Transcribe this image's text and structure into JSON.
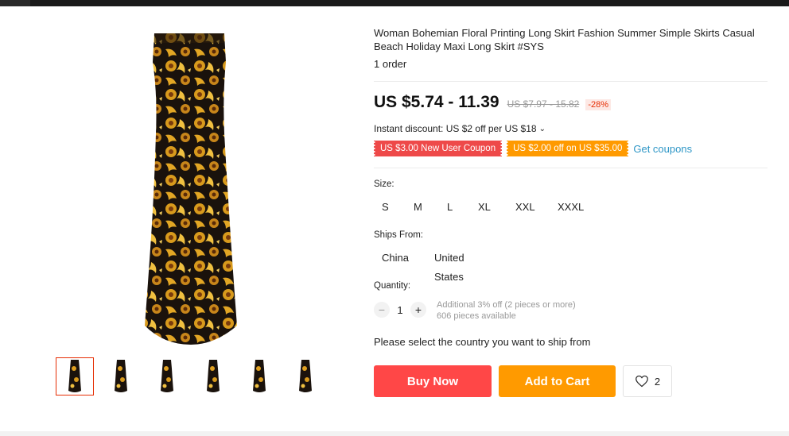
{
  "product": {
    "title": "Woman Bohemian Floral Printing Long Skirt Fashion Summer Simple Skirts Casual Beach Holiday Maxi Long Skirt #SYS",
    "orders": "1 order",
    "price": "US $5.74 - 11.39",
    "old_price": "US $7.97 - 15.82",
    "discount": "-28%",
    "instant_discount": "Instant discount: US $2 off per US $18",
    "coupons": [
      "US $3.00 New User Coupon",
      "US $2.00 off on US $35.00"
    ],
    "get_coupons": "Get coupons"
  },
  "size": {
    "label": "Size:",
    "options": [
      "S",
      "M",
      "L",
      "XL",
      "XXL",
      "XXXL"
    ]
  },
  "ships_from": {
    "label": "Ships From:",
    "options": [
      "China",
      "United States"
    ]
  },
  "quantity": {
    "label": "Quantity:",
    "value": "1",
    "minus": "−",
    "plus": "+",
    "additional": "Additional 3% off (2 pieces or more)",
    "available": "606 pieces available"
  },
  "ship_message": "Please select the country you want to ship from",
  "actions": {
    "buy_now": "Buy Now",
    "add_to_cart": "Add to Cart",
    "wishlist_count": "2"
  },
  "gallery": {
    "thumb_count": 6,
    "active_index": 0
  },
  "colors": {
    "buy": "#ff4747",
    "cart": "#ff9a00",
    "coupon_red": "#ee4949",
    "coupon_orange": "#ff9a00",
    "link": "#2d96c6",
    "discount": "#e62e04"
  },
  "icons": {
    "wishlist": "heart-icon",
    "instant_discount": "chevron-down-icon"
  }
}
